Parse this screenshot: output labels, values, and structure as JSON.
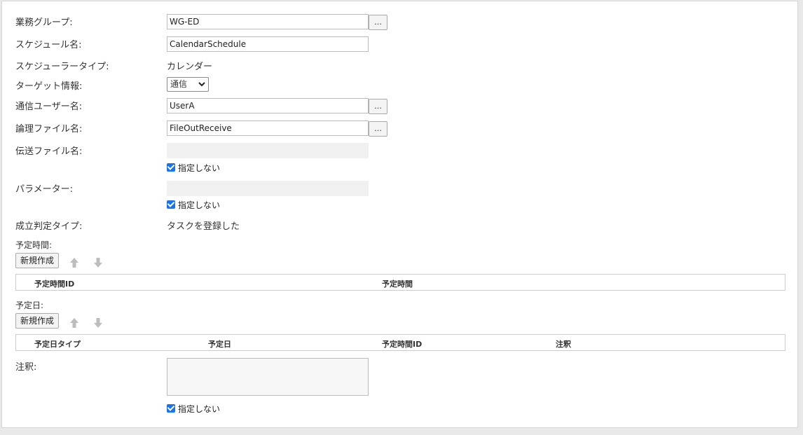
{
  "form": {
    "group_label": "業務グループ:",
    "group_value": "WG-ED",
    "schedule_name_label": "スケジュール名:",
    "schedule_name_value": "CalendarSchedule",
    "scheduler_type_label": "スケジューラータイプ:",
    "scheduler_type_value": "カレンダー",
    "target_label": "ターゲット情報:",
    "target_value": "通信",
    "comm_user_label": "通信ユーザー名:",
    "comm_user_value": "UserA",
    "logical_file_label": "論理ファイル名:",
    "logical_file_value": "FileOutReceive",
    "transfer_file_label": "伝送ファイル名:",
    "transfer_file_value": "",
    "parameter_label": "パラメーター:",
    "parameter_value": "",
    "success_type_label": "成立判定タイプ:",
    "success_type_value": "タスクを登録した",
    "notes_label": "注釈:",
    "notes_value": "",
    "browse_label": "…",
    "not_specified": "指定しない"
  },
  "schedule_time": {
    "section_label": "予定時間:",
    "new_button": "新規作成",
    "columns": [
      "予定時間ID",
      "予定時間"
    ]
  },
  "schedule_date": {
    "section_label": "予定日:",
    "new_button": "新規作成",
    "columns": [
      "予定日タイプ",
      "予定日",
      "予定時間ID",
      "注釈"
    ]
  },
  "colors": {
    "checkbox": "#1a73e8",
    "arrow_disabled": "#bdbdbd"
  }
}
